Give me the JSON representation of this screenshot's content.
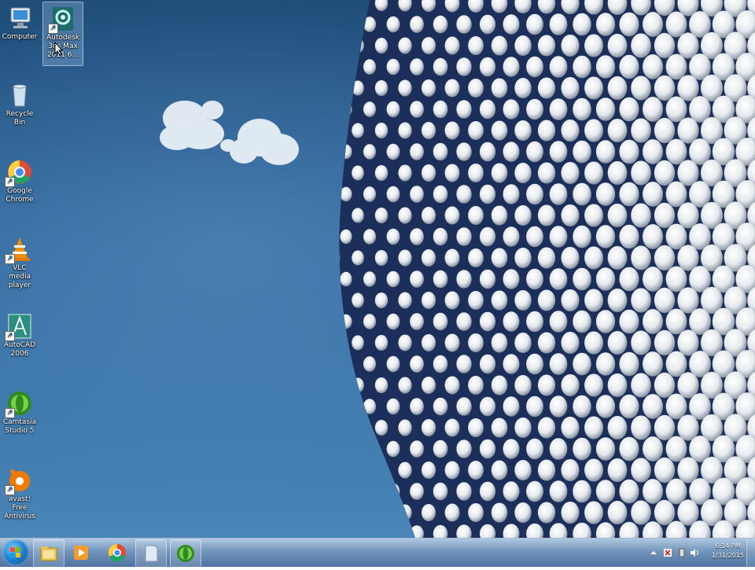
{
  "desktop": {
    "icons": [
      {
        "name": "Computer",
        "label": "Computer"
      },
      {
        "name": "Autodesk 3ds Max",
        "label": "Autodesk 3ds Max 2011 6..."
      },
      {
        "name": "Recycle Bin",
        "label": "Recycle Bin"
      },
      {
        "name": "Google Chrome",
        "label": "Google Chrome"
      },
      {
        "name": "VLC media player",
        "label": "VLC media player"
      },
      {
        "name": "AutoCAD 2006",
        "label": "AutoCAD 2006"
      },
      {
        "name": "Camtasia Studio 5",
        "label": "Camtasia Studio 5"
      },
      {
        "name": "avast! Free Antivirus",
        "label": "avast! Free Antivirus"
      }
    ]
  },
  "taskbar": {
    "start_icon": "windows-start-orb-icon",
    "pinned": [
      "windows-explorer-icon",
      "media-player-icon",
      "chrome-icon",
      "document-icon",
      "camtasia-icon"
    ],
    "tray": {
      "time": "6:14 PM",
      "date": "1/31/2015"
    }
  },
  "colors": {
    "sky": "#2b6196",
    "taskbar": "#5a82af"
  }
}
